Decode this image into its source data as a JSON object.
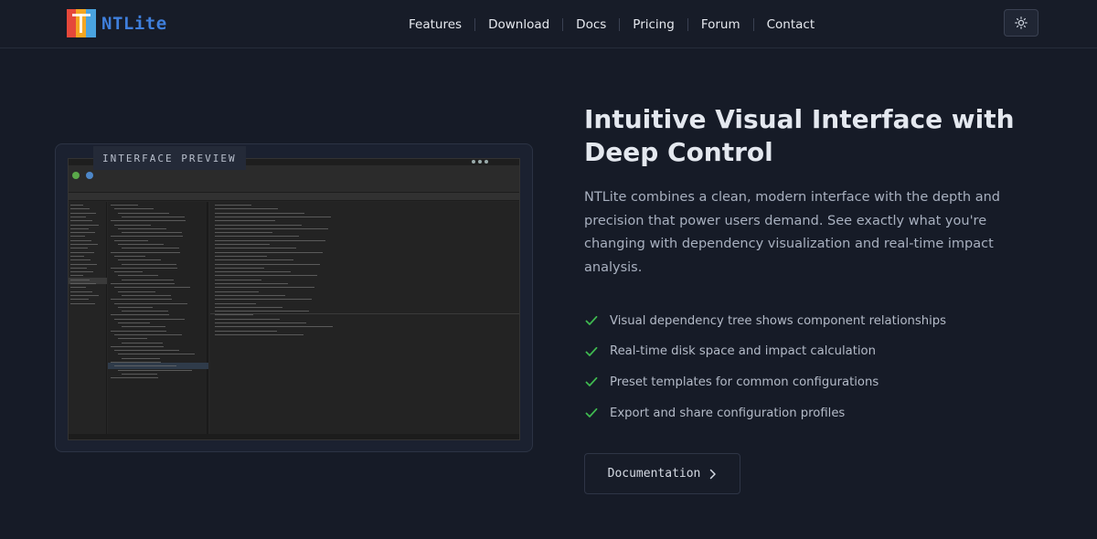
{
  "brand": {
    "name": "NTLite"
  },
  "nav": {
    "items": [
      {
        "label": "Features"
      },
      {
        "label": "Download"
      },
      {
        "label": "Docs"
      },
      {
        "label": "Pricing"
      },
      {
        "label": "Forum"
      },
      {
        "label": "Contact"
      }
    ],
    "theme_icon": "sun-icon"
  },
  "preview": {
    "tag": "INTERFACE PREVIEW"
  },
  "content": {
    "heading_line1": "Intuitive Visual Interface with",
    "heading_line2": "Deep Control",
    "description": "NTLite combines a clean, modern interface with the depth and precision that power users demand. See exactly what you're changing with dependency visualization and real-time impact analysis.",
    "features": [
      {
        "text": "Visual dependency tree shows component relationships"
      },
      {
        "text": "Real-time disk space and impact calculation"
      },
      {
        "text": "Preset templates for common configurations"
      },
      {
        "text": "Export and share configuration profiles"
      }
    ],
    "button_label": "Documentation"
  },
  "colors": {
    "background": "#161b27",
    "accent_green": "#3fb950",
    "logo_blue": "#3f7fdc"
  }
}
